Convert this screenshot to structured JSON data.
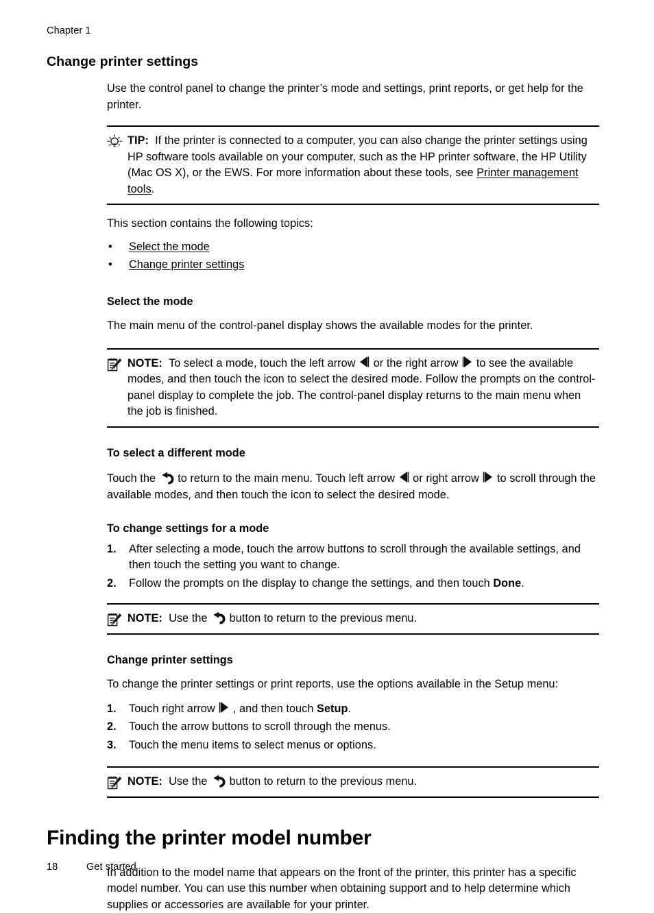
{
  "page": {
    "running_header": "Chapter 1",
    "footer_page_number": "18",
    "footer_section": "Get started"
  },
  "section": {
    "heading": "Change printer settings",
    "intro": "Use the control panel to change the printer’s mode and settings, print reports, or get help for the printer.",
    "tip": {
      "icon": "lightbulb-icon",
      "label": "TIP:",
      "text_before_link": "If the printer is connected to a computer, you can also change the printer settings using HP software tools available on your computer, such as the HP printer software, the HP Utility (Mac OS X), or the EWS. For more information about these tools, see ",
      "link_text": "Printer management tools",
      "text_after_link": "."
    },
    "topics_intro": "This section contains the following topics:",
    "topics": [
      {
        "label": "Select the mode"
      },
      {
        "label": "Change printer settings"
      }
    ]
  },
  "select_the_mode": {
    "heading": "Select the mode",
    "body": "The main menu of the control-panel display shows the available modes for the printer.",
    "note": {
      "icon": "note-icon",
      "label": "NOTE:",
      "part1": "To select a mode, touch the left arrow ",
      "part2": " or the right arrow ",
      "part3": " to see the available modes, and then touch the icon to select the desired mode. Follow the prompts on the control-panel display to complete the job. The control-panel display returns to the main menu when the job is finished."
    }
  },
  "different_mode": {
    "heading": "To select a different mode",
    "part1": "Touch the ",
    "part2": " to return to the main menu. Touch left arrow ",
    "part3": " or right arrow ",
    "part4": " to scroll through the available modes, and then touch the icon to select the desired mode."
  },
  "change_settings_for_mode": {
    "heading": "To change settings for a mode",
    "steps": [
      {
        "num": "1.",
        "text": "After selecting a mode, touch the arrow buttons to scroll through the available settings, and then touch the setting you want to change."
      },
      {
        "num": "2.",
        "text_before_bold": "Follow the prompts on the display to change the settings, and then touch ",
        "bold": "Done",
        "text_after_bold": "."
      }
    ],
    "note": {
      "icon": "note-icon",
      "label": "NOTE:",
      "part1": "Use the ",
      "part2": " button to return to the previous menu."
    }
  },
  "change_printer_settings": {
    "heading": "Change printer settings",
    "body": "To change the printer settings or print reports, use the options available in the Setup menu:",
    "steps": [
      {
        "num": "1.",
        "text_before_icon": "Touch right arrow ",
        "text_after_icon": " , and then touch ",
        "bold": "Setup",
        "text_after_bold": "."
      },
      {
        "num": "2.",
        "text": "Touch the arrow buttons to scroll through the menus."
      },
      {
        "num": "3.",
        "text": "Touch the menu items to select menus or options."
      }
    ],
    "note": {
      "icon": "note-icon",
      "label": "NOTE:",
      "part1": "Use the ",
      "part2": " button to return to the previous menu."
    }
  },
  "finding_model_number": {
    "heading": "Finding the printer model number",
    "body": "In addition to the model name that appears on the front of the printer, this printer has a specific model number. You can use this number when obtaining support and to help determine which supplies or accessories are available for your printer."
  },
  "symbols": {
    "bullet": "•",
    "left_arrow_icon": "left-arrow-icon",
    "right_arrow_icon": "right-arrow-icon",
    "back_arrow_icon": "back-arrow-icon"
  },
  "colors": {
    "text": "#000000",
    "background": "#ffffff",
    "rule": "#000000"
  }
}
